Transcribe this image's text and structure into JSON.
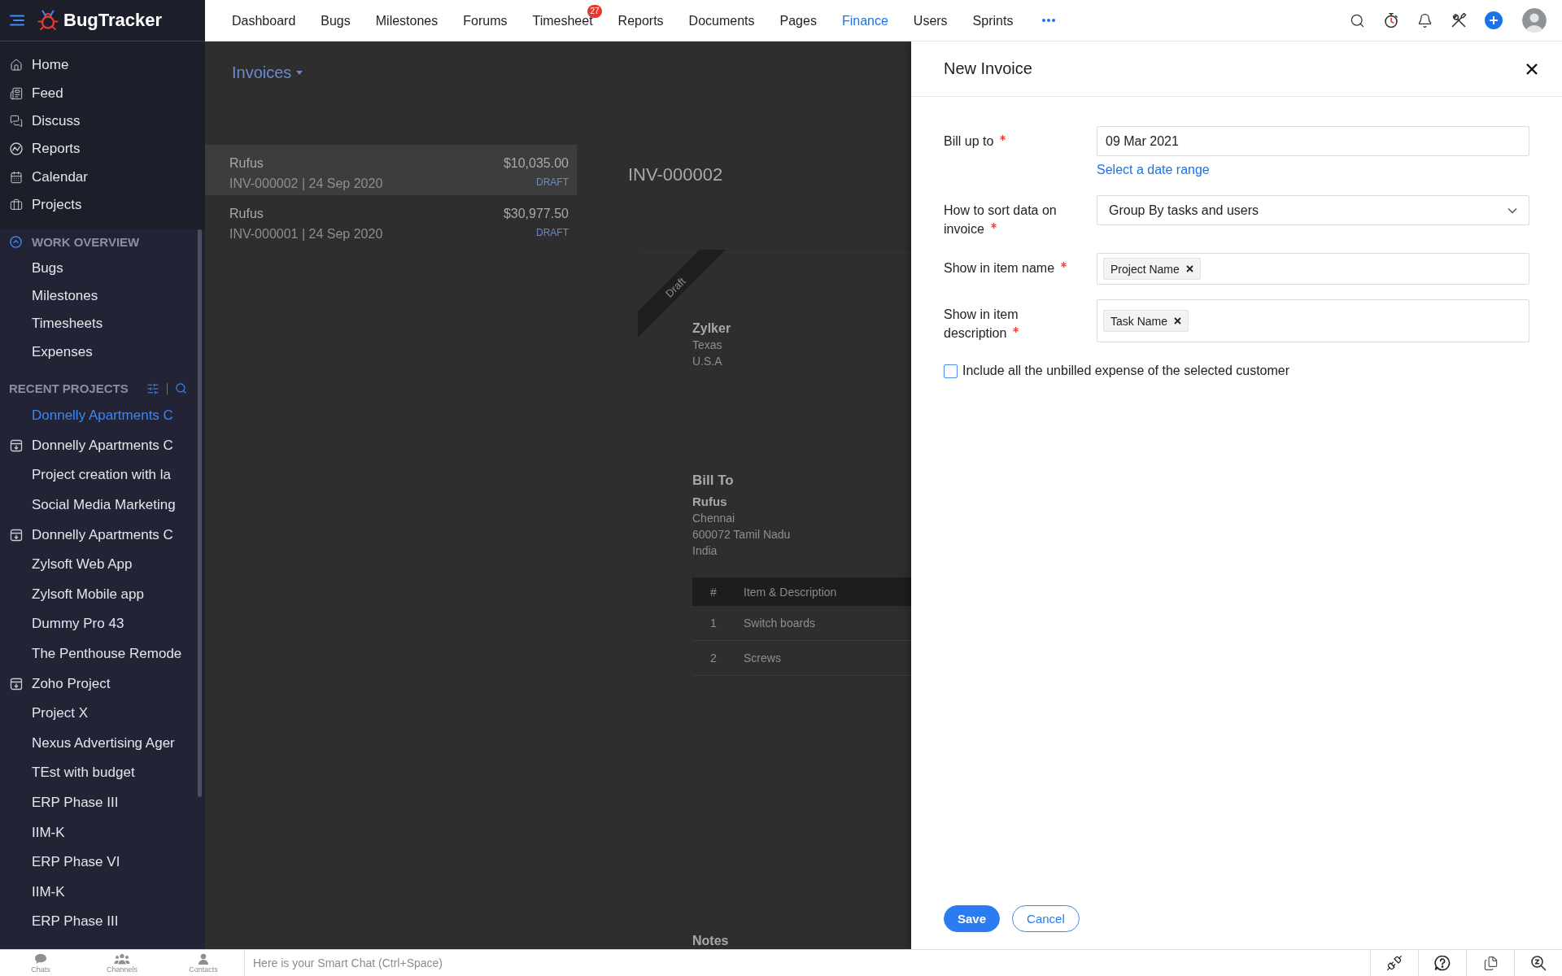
{
  "app": {
    "name": "BugTracker"
  },
  "top_nav": {
    "items": [
      {
        "label": "Dashboard",
        "selected": false
      },
      {
        "label": "Bugs",
        "selected": false
      },
      {
        "label": "Milestones",
        "selected": false
      },
      {
        "label": "Forums",
        "selected": false
      },
      {
        "label": "Timesheet",
        "selected": false,
        "badge": "27"
      },
      {
        "label": "Reports",
        "selected": false
      },
      {
        "label": "Documents",
        "selected": false
      },
      {
        "label": "Pages",
        "selected": false
      },
      {
        "label": "Finance",
        "selected": true
      },
      {
        "label": "Users",
        "selected": false
      },
      {
        "label": "Sprints",
        "selected": false
      }
    ]
  },
  "sidebar": {
    "main_items": [
      {
        "label": "Home"
      },
      {
        "label": "Feed"
      },
      {
        "label": "Discuss"
      },
      {
        "label": "Reports"
      },
      {
        "label": "Calendar"
      },
      {
        "label": "Projects"
      }
    ],
    "work_overview": {
      "title": "WORK OVERVIEW",
      "expanded": true,
      "items": [
        {
          "label": "Bugs"
        },
        {
          "label": "Milestones"
        },
        {
          "label": "Timesheets"
        },
        {
          "label": "Expenses"
        }
      ]
    },
    "recent_projects": {
      "title": "RECENT PROJECTS",
      "items": [
        {
          "label": "Donnelly Apartments C",
          "selected": true,
          "archived": false
        },
        {
          "label": "Donnelly Apartments C",
          "selected": false,
          "archived": true
        },
        {
          "label": "Project creation with la",
          "selected": false,
          "archived": false
        },
        {
          "label": "Social Media Marketing",
          "selected": false,
          "archived": false
        },
        {
          "label": "Donnelly Apartments C",
          "selected": false,
          "archived": true
        },
        {
          "label": "Zylsoft Web App",
          "selected": false,
          "archived": false
        },
        {
          "label": "Zylsoft Mobile app",
          "selected": false,
          "archived": false
        },
        {
          "label": "Dummy Pro 43",
          "selected": false,
          "archived": false
        },
        {
          "label": "The Penthouse Remode",
          "selected": false,
          "archived": false
        },
        {
          "label": "Zoho Project",
          "selected": false,
          "archived": true
        },
        {
          "label": "Project X",
          "selected": false,
          "archived": false
        },
        {
          "label": "Nexus Advertising Ager",
          "selected": false,
          "archived": false
        },
        {
          "label": "TEst with budget",
          "selected": false,
          "archived": false
        },
        {
          "label": "ERP Phase III",
          "selected": false,
          "archived": false
        },
        {
          "label": "IIM-K",
          "selected": false,
          "archived": false
        },
        {
          "label": "ERP Phase VI",
          "selected": false,
          "archived": false
        },
        {
          "label": "IIM-K",
          "selected": false,
          "archived": false
        },
        {
          "label": "ERP Phase III",
          "selected": false,
          "archived": false
        }
      ]
    }
  },
  "invoices": {
    "title": "Invoices",
    "list": [
      {
        "customer": "Rufus",
        "reference": "INV-000002 | 24 Sep 2020",
        "amount": "$10,035.00",
        "status": "DRAFT",
        "selected": true
      },
      {
        "customer": "Rufus",
        "reference": "INV-000001 | 24 Sep 2020",
        "amount": "$30,977.50",
        "status": "DRAFT",
        "selected": false
      }
    ],
    "preview": {
      "number": "INV-000002",
      "ribbon": "Draft",
      "company": {
        "name": "Zylker",
        "address": [
          "Texas",
          "U.S.A"
        ]
      },
      "bill_to": {
        "title": "Bill To",
        "name": "Rufus",
        "address": [
          "Chennai",
          "600072 Tamil Nadu",
          "India"
        ]
      },
      "items_table": {
        "columns": [
          "#",
          "Item & Description"
        ],
        "rows": [
          [
            "1",
            "Switch boards"
          ],
          [
            "2",
            "Screws"
          ]
        ]
      },
      "notes_title": "Notes"
    }
  },
  "new_invoice": {
    "title": "New Invoice",
    "fields": [
      {
        "kind": "date",
        "label": "Bill up to",
        "required": true,
        "value": "09 Mar 2021",
        "link": "Select a date range"
      },
      {
        "kind": "select",
        "label": "How to sort data on invoice",
        "required": true,
        "value": "Group By tasks and users"
      },
      {
        "kind": "tags",
        "label": "Show in item name",
        "required": true,
        "tags": [
          "Project Name"
        ]
      },
      {
        "kind": "tags",
        "label": "Show in item description",
        "required": true,
        "tags": [
          "Task Name"
        ]
      }
    ],
    "checkbox": {
      "label": "Include all the unbilled expense of the selected customer",
      "checked": false
    },
    "buttons": [
      {
        "label": "Save",
        "kind": "primary"
      },
      {
        "label": "Cancel",
        "kind": "secondary"
      }
    ]
  },
  "chat_bar": {
    "tabs": [
      {
        "label": "Chats"
      },
      {
        "label": "Channels"
      },
      {
        "label": "Contacts"
      }
    ],
    "placeholder": "Here is your Smart Chat (Ctrl+Space)"
  }
}
